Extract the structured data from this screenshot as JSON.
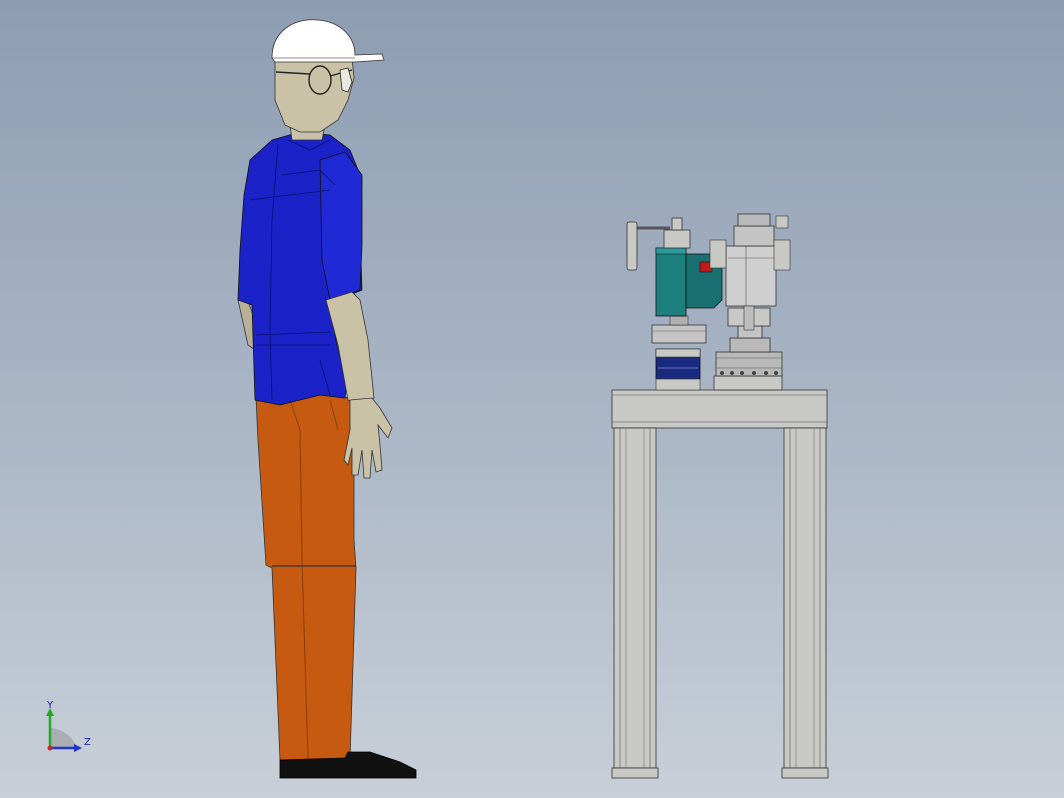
{
  "viewport": {
    "background_top": "#8d9db2",
    "background_bottom": "#c8cfd8"
  },
  "triad": {
    "y_label": "Y",
    "z_label": "Z",
    "y_color": "#22aa22",
    "z_color": "#2233cc",
    "origin_color": "#cc2222"
  },
  "colors": {
    "shirt": "#1a22c8",
    "pants": "#c65a10",
    "skin": "#c9c2a6",
    "helmet": "#ffffff",
    "shoe": "#111111",
    "table": "#c8c8c4",
    "machine_teal": "#1e7f7f",
    "machine_gray": "#b9b9b9",
    "machine_navy": "#1a2a80"
  }
}
